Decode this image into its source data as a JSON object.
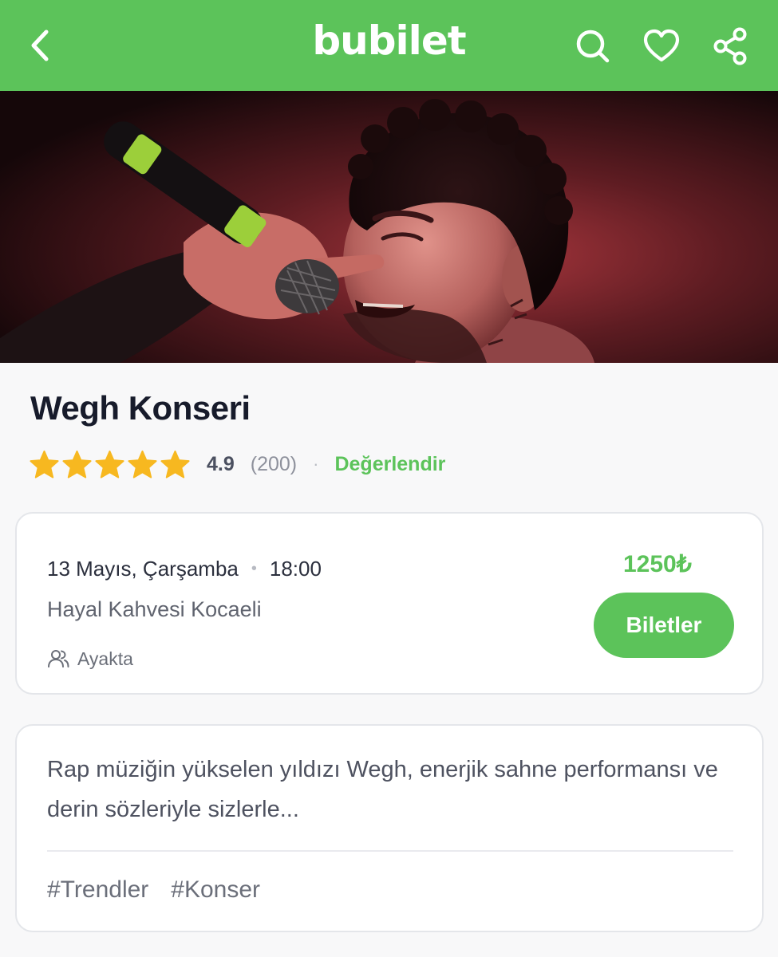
{
  "header": {
    "brand": "bubilet",
    "color": "#5cc35a",
    "icons": [
      "back-arrow-icon",
      "search-icon",
      "heart-icon",
      "share-icon"
    ]
  },
  "hero": {
    "description_icon": "concert-photo"
  },
  "event": {
    "title": "Wegh Konseri",
    "rating": {
      "stars": 5,
      "score": "4.9",
      "count": "(200)",
      "separator": "·",
      "rate_label": "Değerlendir"
    }
  },
  "session": {
    "date": "13 Mayıs, Çarşamba",
    "separator": "•",
    "time": "18:00",
    "venue": "Hayal Kahvesi Kocaeli",
    "seating": "Ayakta",
    "price": "1250₺",
    "button_label": "Biletler"
  },
  "description": {
    "text": "Rap müziğin yükselen yıldızı Wegh, enerjik sahne performansı ve derin sözleriyle sizlerle...",
    "tags": [
      "#Trendler",
      "#Konser"
    ]
  }
}
